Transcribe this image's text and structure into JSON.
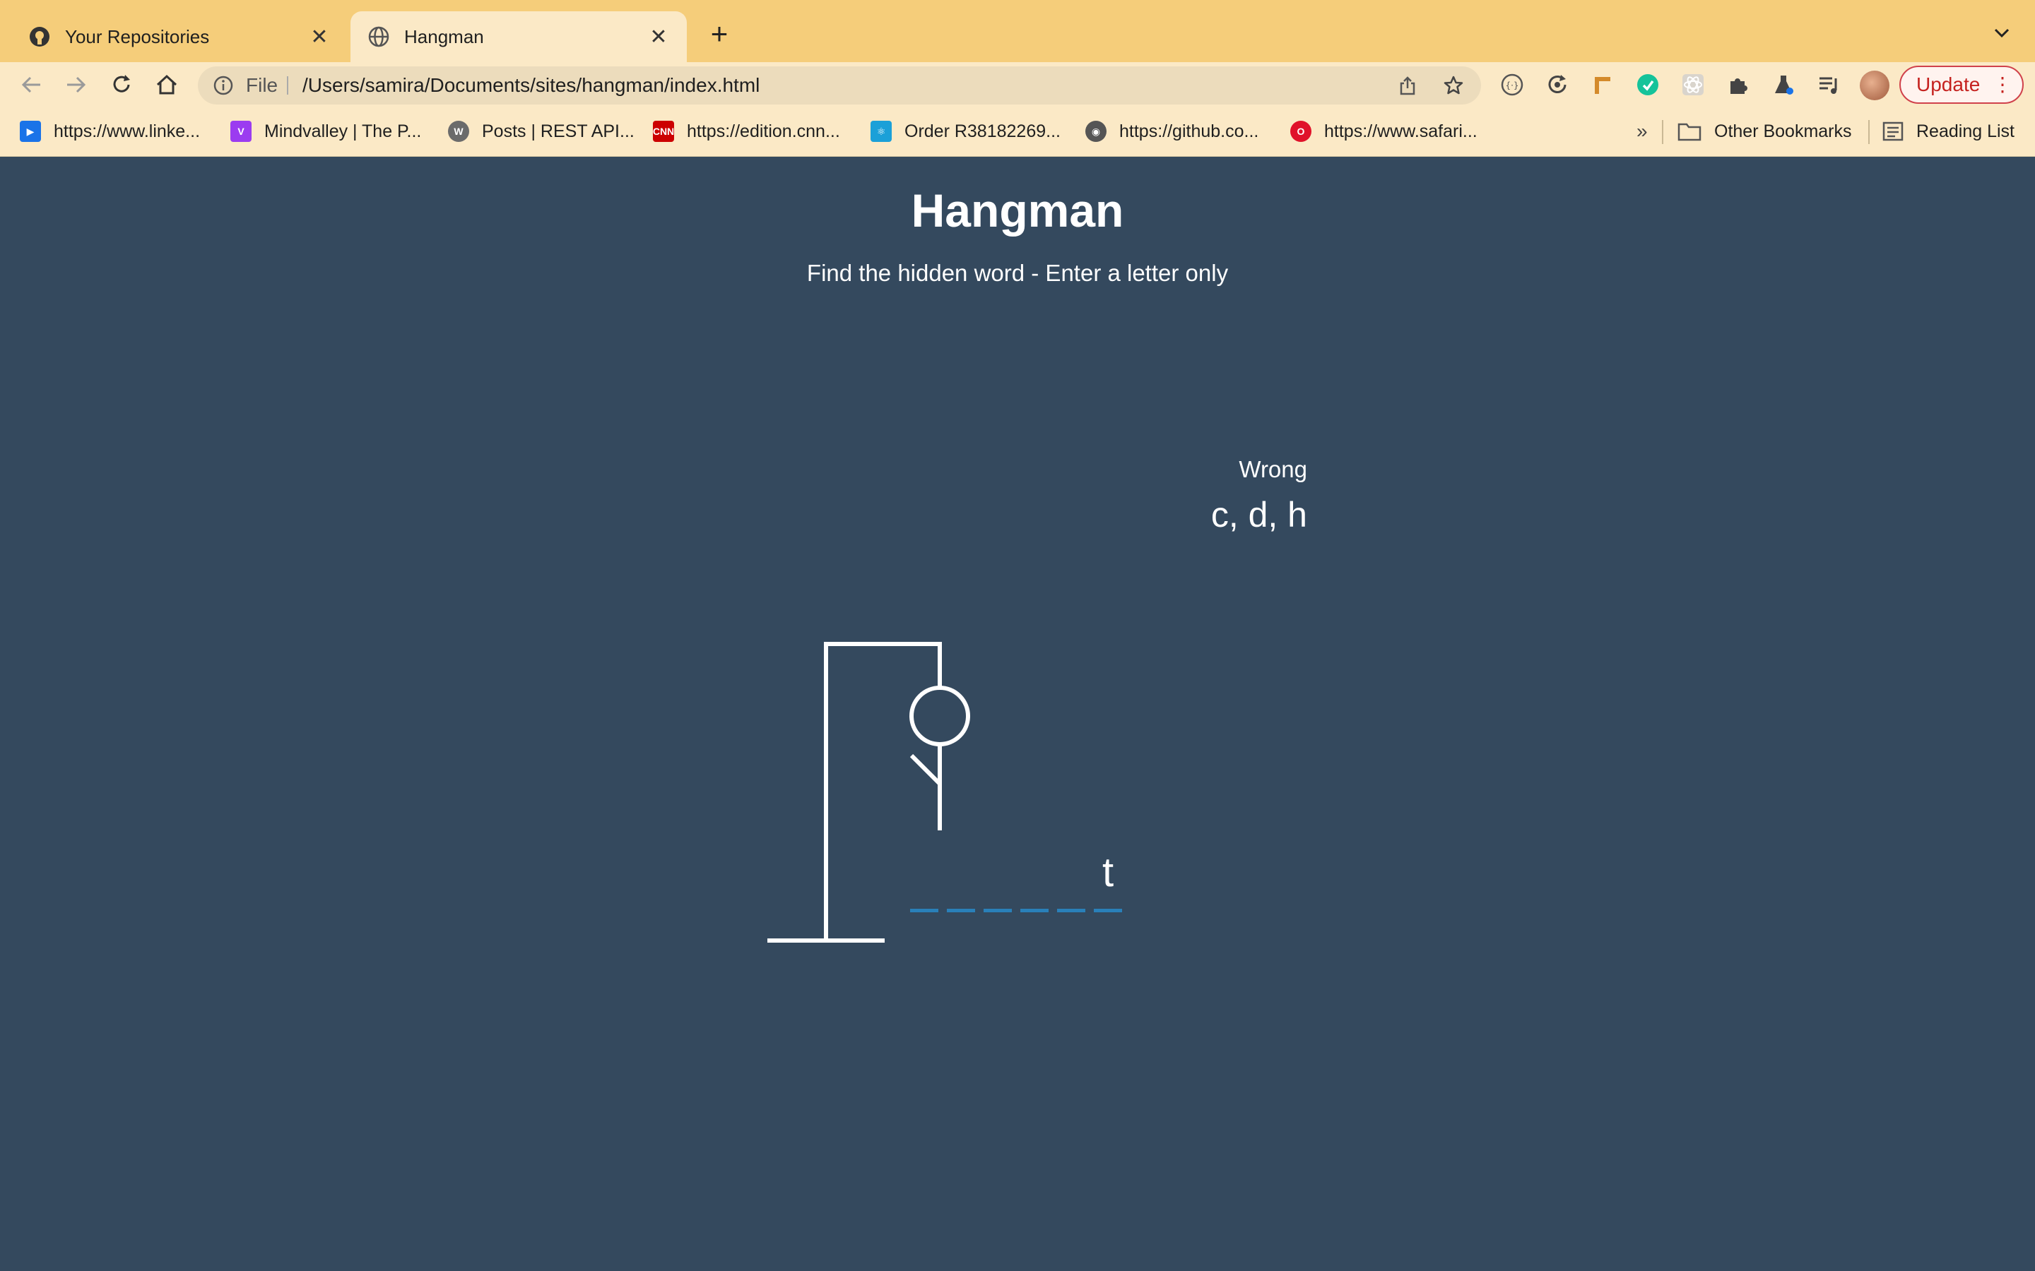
{
  "browser": {
    "tabs": [
      {
        "title": "Your Repositories",
        "active": false,
        "icon": "github-icon"
      },
      {
        "title": "Hangman",
        "active": true,
        "icon": "globe-icon"
      }
    ],
    "new_tab_label": "+",
    "address": {
      "scheme_label": "File",
      "url": "/Users/samira/Documents/sites/hangman/index.html"
    },
    "update_label": "Update",
    "bookmarks": [
      {
        "label": "https://www.linke...",
        "icon": "video-icon",
        "color": "#1a73e8"
      },
      {
        "label": "Mindvalley | The P...",
        "icon": "mindvalley-icon",
        "color": "#9b3cf0"
      },
      {
        "label": "Posts | REST API...",
        "icon": "wordpress-icon",
        "color": "#6b6b6b"
      },
      {
        "label": "https://edition.cnn...",
        "icon": "cnn-icon",
        "color": "#cc0000"
      },
      {
        "label": "Order R38182269...",
        "icon": "react-icon",
        "color": "#1ba0d8"
      },
      {
        "label": "https://github.co...",
        "icon": "github-icon",
        "color": "#555555"
      },
      {
        "label": "https://www.safari...",
        "icon": "safari-icon",
        "color": "#e0122a"
      }
    ],
    "overflow_label": "»",
    "other_bookmarks_label": "Other Bookmarks",
    "reading_list_label": "Reading List"
  },
  "game": {
    "title": "Hangman",
    "subtitle": "Find the hidden word - Enter a letter only",
    "wrong_label": "Wrong",
    "wrong_letters": "c, d, h",
    "word_slots": [
      "",
      "",
      "",
      "",
      "",
      "t"
    ],
    "figure_parts_shown": [
      "head",
      "body",
      "left-arm"
    ],
    "colors": {
      "background": "#34495e",
      "text": "#ffffff",
      "dash": "#2980b9"
    }
  }
}
